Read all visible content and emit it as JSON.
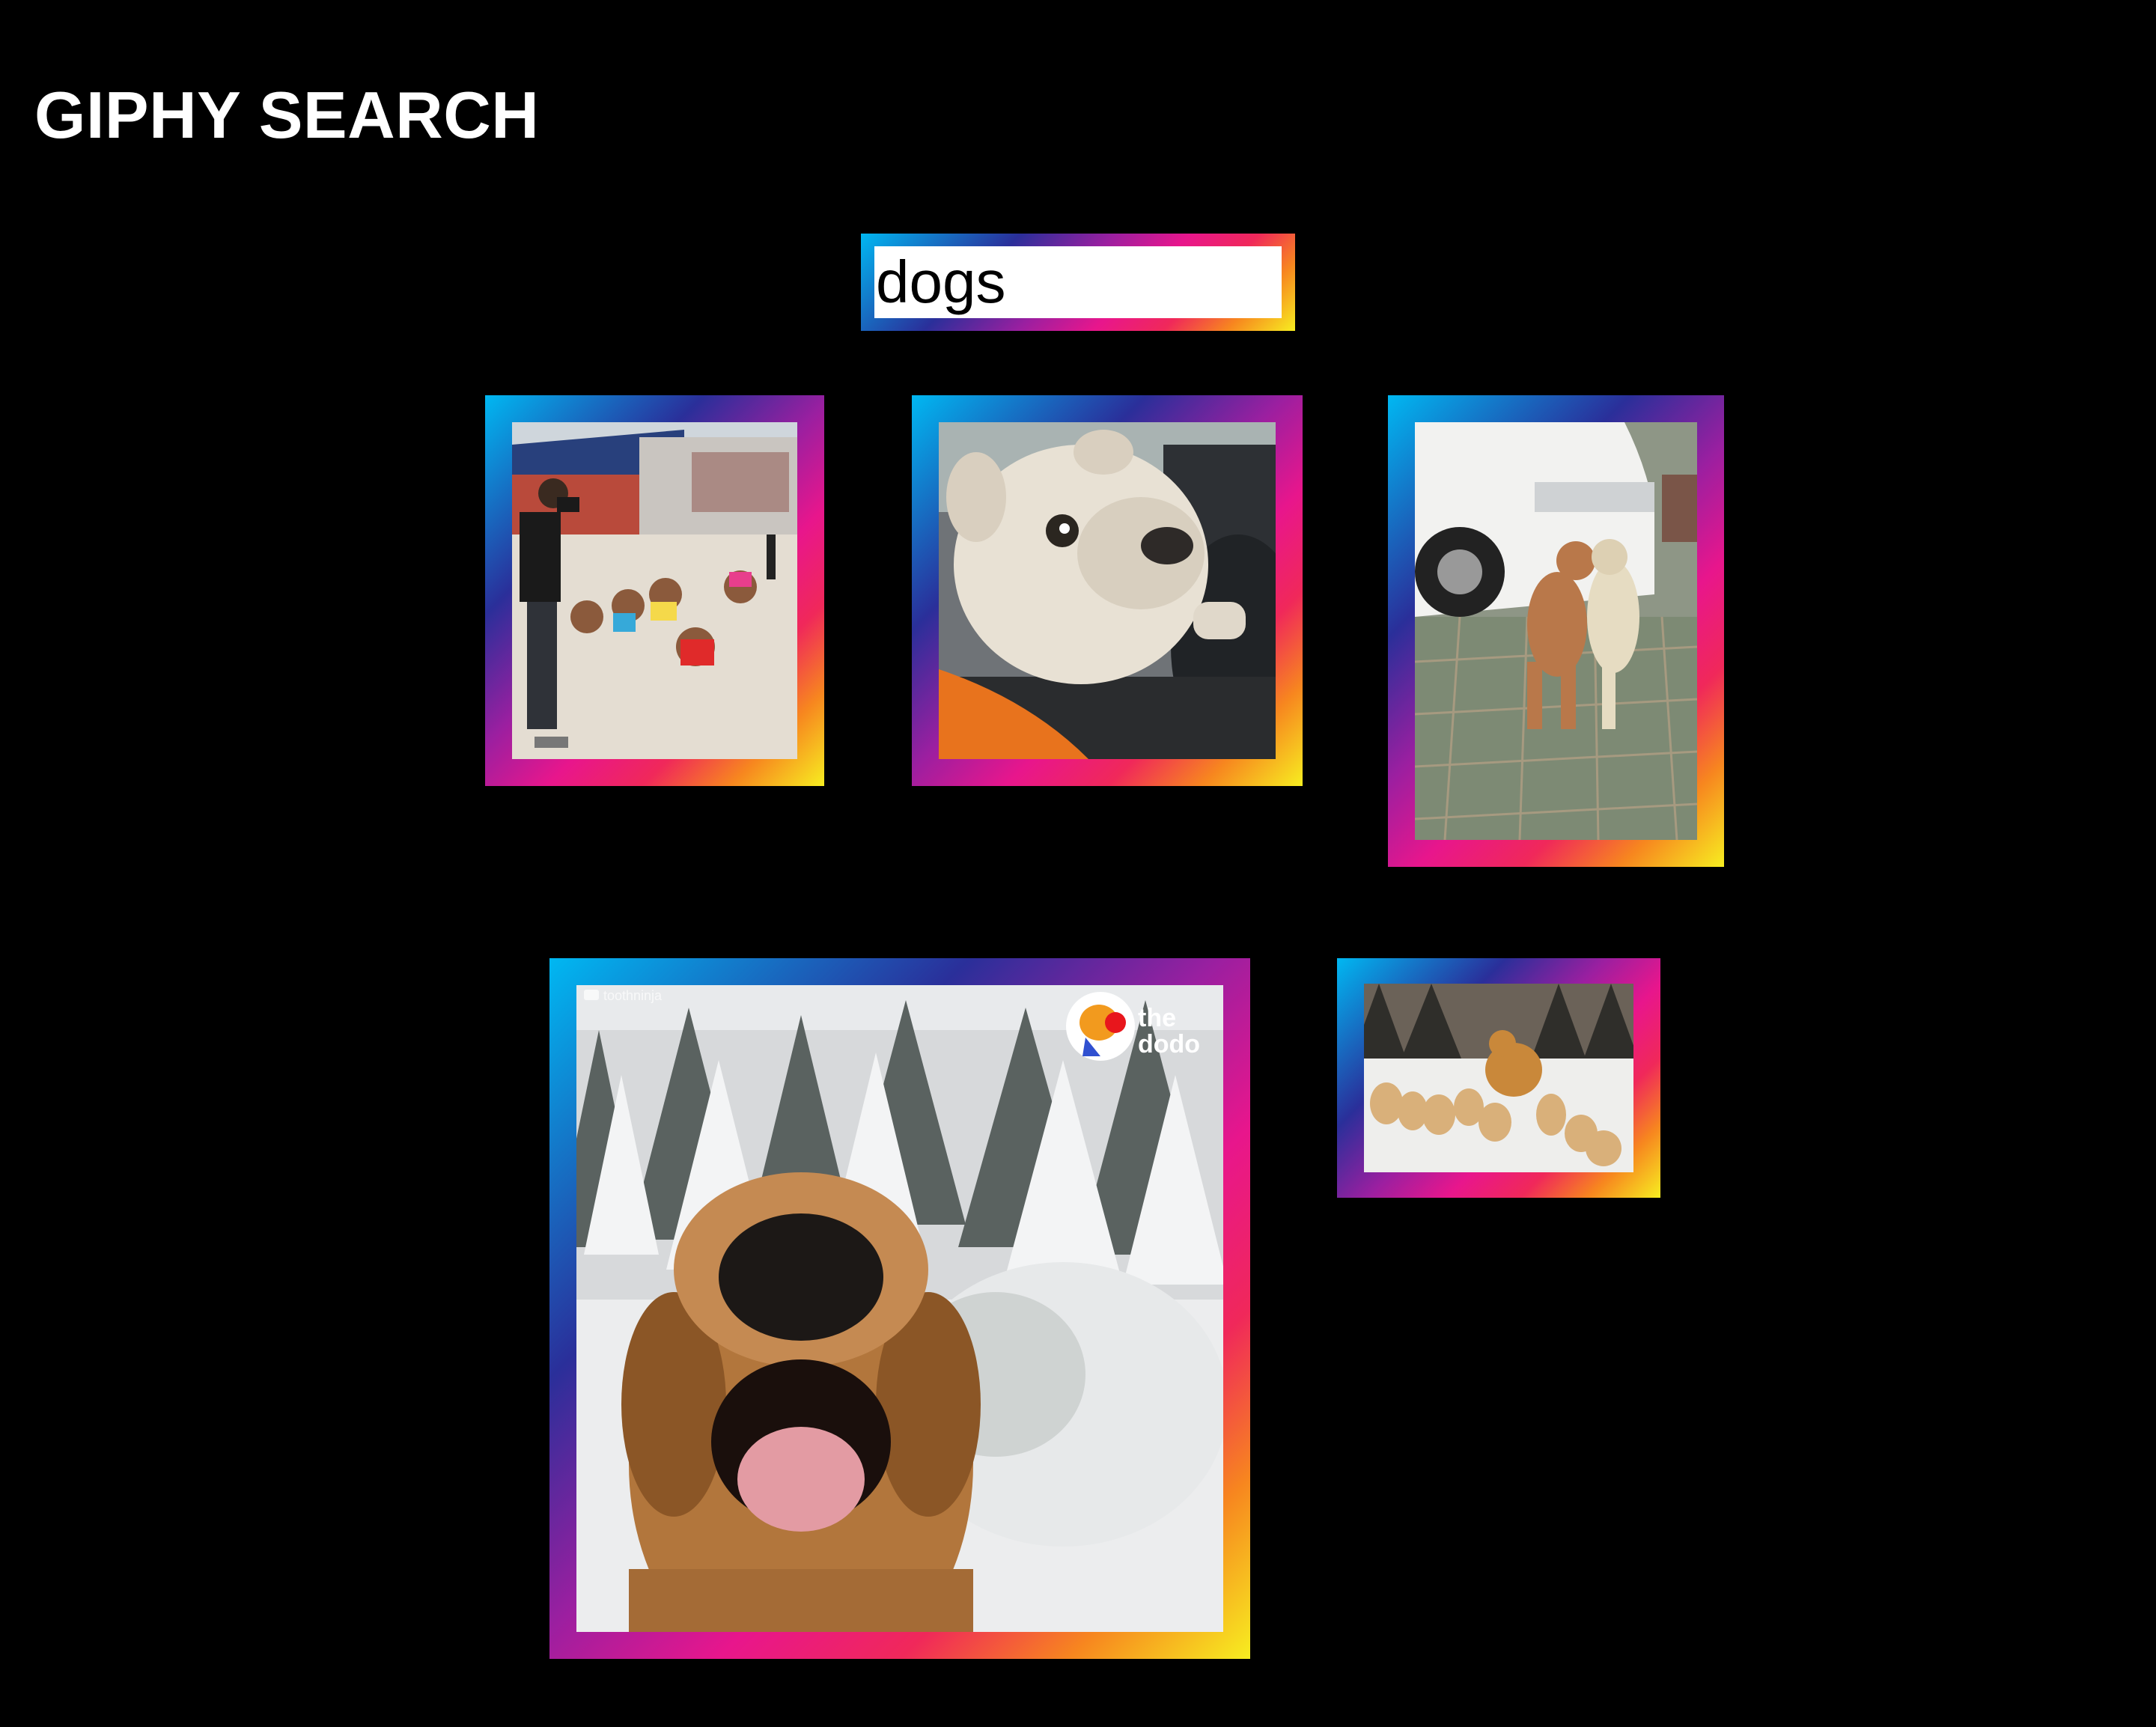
{
  "header": {
    "title": "GIPHY SEARCH"
  },
  "search": {
    "value": "dogs"
  },
  "results": [
    {
      "id": 1,
      "subject": "man with jumping poodles in costumes"
    },
    {
      "id": 2,
      "subject": "bulldog driving a car"
    },
    {
      "id": 3,
      "subject": "two dogs hugging by white car"
    },
    {
      "id": 4,
      "subject": "golden retriever running in snowy forest",
      "watermark": "toothninja",
      "logo_text_1": "the",
      "logo_text_2": "dodo"
    },
    {
      "id": 5,
      "subject": "golden retriever with puppies in snow"
    }
  ],
  "colors": {
    "background": "#000000",
    "gradient": [
      "#00b8f2",
      "#2a2f9a",
      "#9c1fa0",
      "#e8168c",
      "#f0285a",
      "#f7861f",
      "#f7ee20"
    ]
  }
}
